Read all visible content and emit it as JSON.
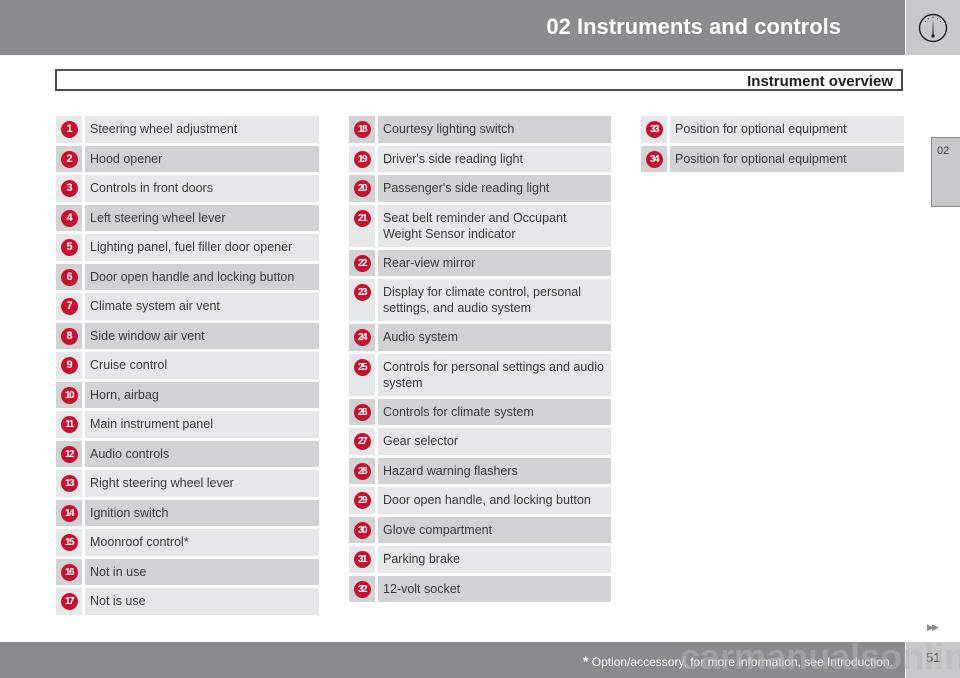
{
  "header": {
    "chapter_title": "02 Instruments and controls",
    "icon": "gauge-icon"
  },
  "section": {
    "title": "Instrument overview"
  },
  "side_tab": {
    "label": "02"
  },
  "columns": [
    {
      "items": [
        {
          "num": "1",
          "label": "Steering wheel adjustment",
          "shade": "light"
        },
        {
          "num": "2",
          "label": "Hood opener",
          "shade": "dark"
        },
        {
          "num": "3",
          "label": "Controls in front doors",
          "shade": "light"
        },
        {
          "num": "4",
          "label": "Left steering wheel lever",
          "shade": "dark"
        },
        {
          "num": "5",
          "label": "Lighting panel, fuel filler door opener",
          "shade": "light"
        },
        {
          "num": "6",
          "label": "Door open handle and locking button",
          "shade": "dark"
        },
        {
          "num": "7",
          "label": "Climate system air vent",
          "shade": "light"
        },
        {
          "num": "8",
          "label": "Side window air vent",
          "shade": "dark"
        },
        {
          "num": "9",
          "label": "Cruise control",
          "shade": "light"
        },
        {
          "num": "10",
          "label": "Horn, airbag",
          "shade": "dark"
        },
        {
          "num": "11",
          "label": "Main instrument panel",
          "shade": "light"
        },
        {
          "num": "12",
          "label": "Audio controls",
          "shade": "dark"
        },
        {
          "num": "13",
          "label": "Right steering wheel lever",
          "shade": "light"
        },
        {
          "num": "14",
          "label": "Ignition switch",
          "shade": "dark"
        },
        {
          "num": "15",
          "label": "Moonroof control*",
          "shade": "light"
        },
        {
          "num": "16",
          "label": "Not in use",
          "shade": "dark"
        },
        {
          "num": "17",
          "label": "Not is use",
          "shade": "light"
        }
      ]
    },
    {
      "items": [
        {
          "num": "18",
          "label": "Courtesy lighting switch",
          "shade": "dark"
        },
        {
          "num": "19",
          "label": "Driver's side reading light",
          "shade": "light"
        },
        {
          "num": "20",
          "label": "Passenger's side reading light",
          "shade": "dark"
        },
        {
          "num": "21",
          "label": "Seat belt reminder and Occupant Weight Sensor indicator",
          "shade": "light"
        },
        {
          "num": "22",
          "label": "Rear-view mirror",
          "shade": "dark"
        },
        {
          "num": "23",
          "label": "Display for climate control, personal settings, and audio system",
          "shade": "light"
        },
        {
          "num": "24",
          "label": "Audio system",
          "shade": "dark"
        },
        {
          "num": "25",
          "label": "Controls for personal settings and audio system",
          "shade": "light"
        },
        {
          "num": "26",
          "label": "Controls for climate system",
          "shade": "dark"
        },
        {
          "num": "27",
          "label": "Gear selector",
          "shade": "light"
        },
        {
          "num": "28",
          "label": "Hazard warning flashers",
          "shade": "dark"
        },
        {
          "num": "29",
          "label": "Door open handle, and locking button",
          "shade": "light"
        },
        {
          "num": "30",
          "label": "Glove compartment",
          "shade": "dark"
        },
        {
          "num": "31",
          "label": "Parking brake",
          "shade": "light"
        },
        {
          "num": "32",
          "label": "12-volt socket",
          "shade": "dark"
        }
      ]
    },
    {
      "items": [
        {
          "num": "33",
          "label": "Position for optional equipment",
          "shade": "light"
        },
        {
          "num": "34",
          "label": "Position for optional equipment",
          "shade": "dark"
        }
      ]
    }
  ],
  "footer": {
    "note_star": "*",
    "note": " Option/accessory, for more information, see Introduction.",
    "page_number": "51",
    "continue_icon": "double-arrow-right-icon",
    "continue_glyph": "▶▶",
    "watermark": "carmanualsonline.info"
  },
  "colors": {
    "badge": "#c8102e",
    "row_light": "#e6e7e8",
    "row_dark": "#d1d2d4",
    "header_bar": "#8a8b8e",
    "header_icon_box": "#c8c9cb"
  }
}
